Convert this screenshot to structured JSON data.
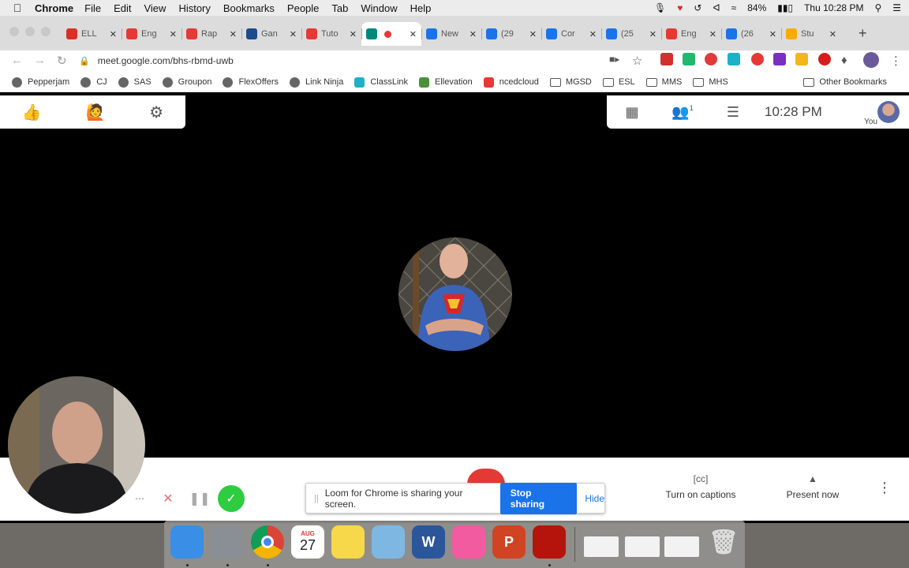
{
  "menubar": {
    "app_name": "Chrome",
    "items": [
      "File",
      "Edit",
      "View",
      "History",
      "Bookmarks",
      "People",
      "Tab",
      "Window",
      "Help"
    ],
    "battery": "84%",
    "datetime": "Thu 10:28 PM"
  },
  "tabs": [
    {
      "title": "ELL",
      "icon_color": "#d93025"
    },
    {
      "title": "Eng",
      "icon_color": "#e53935"
    },
    {
      "title": "Rap",
      "icon_color": "#e53935"
    },
    {
      "title": "Gan",
      "icon_color": "#1e4a8c"
    },
    {
      "title": "Tuto",
      "icon_color": "#e53935"
    },
    {
      "title": "",
      "icon_color": "#00897b",
      "active": true
    },
    {
      "title": "New",
      "icon_color": "#1a73e8"
    },
    {
      "title": "(29",
      "icon_color": "#1a73e8"
    },
    {
      "title": "Cor",
      "icon_color": "#1a73e8"
    },
    {
      "title": "(25",
      "icon_color": "#1a73e8"
    },
    {
      "title": "Eng",
      "icon_color": "#e53935"
    },
    {
      "title": "(26",
      "icon_color": "#1a73e8"
    },
    {
      "title": "Stu",
      "icon_color": "#f9ab00"
    }
  ],
  "address": {
    "url": "meet.google.com/bhs-rbmd-uwb"
  },
  "bookmarks": [
    {
      "label": "Pepperjam",
      "kind": "globe"
    },
    {
      "label": "CJ",
      "kind": "globe"
    },
    {
      "label": "SAS",
      "kind": "globe"
    },
    {
      "label": "Groupon",
      "kind": "globe"
    },
    {
      "label": "FlexOffers",
      "kind": "globe"
    },
    {
      "label": "Link Ninja",
      "kind": "globe"
    },
    {
      "label": "ClassLink",
      "kind": "site"
    },
    {
      "label": "Ellevation",
      "kind": "site"
    },
    {
      "label": "ncedcloud",
      "kind": "site"
    },
    {
      "label": "MGSD",
      "kind": "folder"
    },
    {
      "label": "ESL",
      "kind": "folder"
    },
    {
      "label": "MMS",
      "kind": "folder"
    },
    {
      "label": "MHS",
      "kind": "folder"
    }
  ],
  "other_bookmarks": "Other Bookmarks",
  "meet": {
    "clock": "10:28 PM",
    "participants_count": "1",
    "self_label": "You",
    "captions_label": "Turn on captions",
    "present_label": "Present now"
  },
  "loom": {
    "message": "Loom for Chrome is sharing your screen.",
    "stop_label": "Stop sharing",
    "hide_label": "Hide"
  },
  "dock": [
    {
      "name": "finder",
      "color": "#3a8ee6"
    },
    {
      "name": "launchpad",
      "color": "#8a8f96"
    },
    {
      "name": "chrome",
      "color": "#ffffff"
    },
    {
      "name": "calendar",
      "color": "#ffffff",
      "month": "AUG",
      "day": "27"
    },
    {
      "name": "notes",
      "color": "#f7d84a"
    },
    {
      "name": "preview",
      "color": "#7fb7e3"
    },
    {
      "name": "word",
      "color": "#2b579a",
      "glyph": "W"
    },
    {
      "name": "itunes",
      "color": "#f25ba0"
    },
    {
      "name": "powerpoint",
      "color": "#d04423",
      "glyph": "P"
    },
    {
      "name": "acrobat",
      "color": "#b5140c"
    }
  ]
}
